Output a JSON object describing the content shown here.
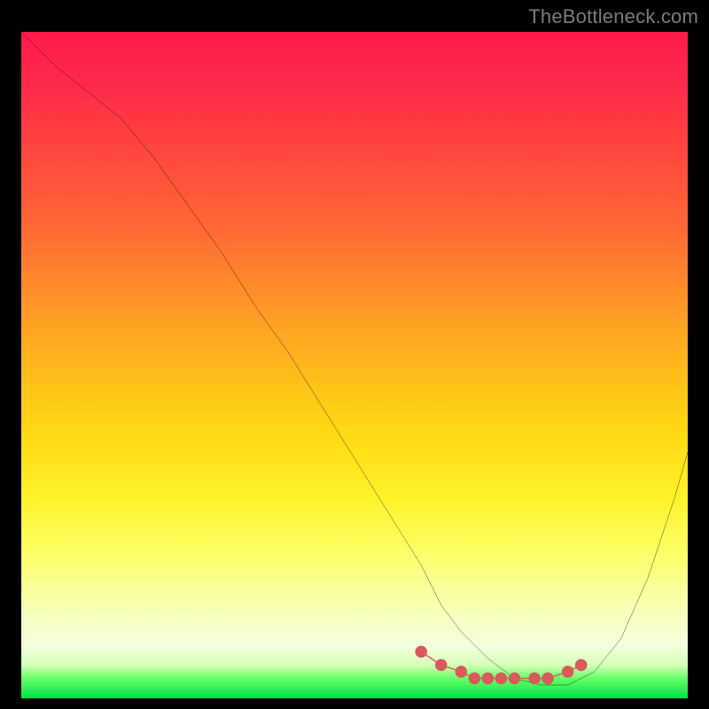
{
  "watermark": "TheBottleneck.com",
  "colors": {
    "background": "#000000",
    "curve_stroke": "#000000",
    "marker_stroke": "#d85a5a",
    "gradient_top": "#ff1a4d",
    "gradient_bottom": "#00e046"
  },
  "chart_data": {
    "type": "line",
    "title": "",
    "xlabel": "",
    "ylabel": "",
    "xlim": [
      0,
      100
    ],
    "ylim": [
      0,
      100
    ],
    "grid": false,
    "legend": false,
    "series": [
      {
        "name": "curve",
        "x": [
          0,
          5,
          10,
          15,
          20,
          25,
          30,
          35,
          40,
          45,
          50,
          55,
          60,
          63,
          66,
          70,
          74,
          78,
          82,
          86,
          90,
          94,
          98,
          100
        ],
        "y": [
          100,
          95,
          91,
          87,
          81,
          74,
          67,
          59,
          52,
          44,
          36,
          28,
          20,
          14,
          10,
          6,
          3,
          2,
          2,
          4,
          9,
          18,
          30,
          37
        ]
      },
      {
        "name": "markers",
        "x": [
          60,
          63,
          66,
          68,
          70,
          72,
          74,
          77,
          79,
          82,
          84
        ],
        "y": [
          7,
          5,
          4,
          3,
          3,
          3,
          3,
          3,
          3,
          4,
          5
        ]
      }
    ],
    "annotations": []
  }
}
